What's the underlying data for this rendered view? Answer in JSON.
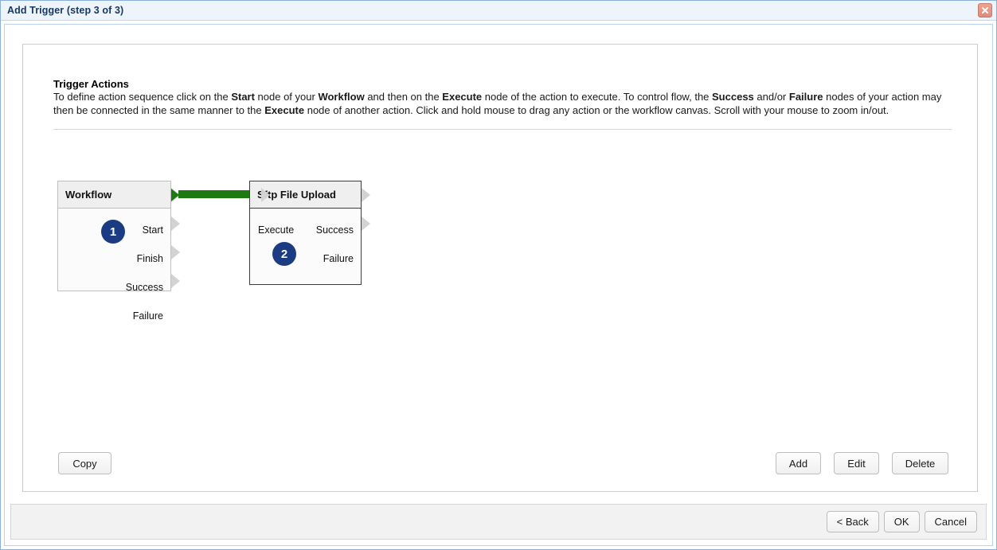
{
  "window": {
    "title": "Add Trigger (step 3 of 3)",
    "close_icon": "close-icon"
  },
  "panel": {
    "section_title": "Trigger Actions",
    "instructions": {
      "p1": "To define action sequence click on the ",
      "b1": "Start",
      "p2": " node of your ",
      "b2": "Workflow",
      "p3": " and then on the ",
      "b3": "Execute",
      "p4": " node of the action to execute. To control flow, the ",
      "b4": "Success",
      "p5": " and/or ",
      "b5": "Failure",
      "p6": " nodes of your action may then be connected in the same manner to the ",
      "b6": "Execute",
      "p7": " node of another action. Click and hold mouse to drag any action or the workflow canvas. Scroll with your mouse to zoom in/out."
    }
  },
  "workflow": {
    "nodes": [
      {
        "id": "workflow-node",
        "title": "Workflow",
        "selected": false,
        "outputs": [
          "Start",
          "Finish",
          "Success",
          "Failure"
        ],
        "inputs": [],
        "badge": "1",
        "badge_port": "Start"
      },
      {
        "id": "sftp-file-upload-node",
        "title": "Sftp File Upload",
        "selected": true,
        "outputs": [
          "Success",
          "Failure"
        ],
        "inputs": [
          "Execute"
        ],
        "badge": "2",
        "badge_port": "Execute"
      }
    ],
    "connection": {
      "from": "Workflow.Start",
      "to": "Sftp File Upload.Execute",
      "color": "#1d7a10"
    }
  },
  "buttons": {
    "copy": "Copy",
    "add": "Add",
    "edit": "Edit",
    "delete": "Delete"
  },
  "footer": {
    "back": "< Back",
    "ok": "OK",
    "cancel": "Cancel"
  },
  "colors": {
    "title_text": "#17375e",
    "titlebar_bg": "#eef4fc",
    "badge_bg": "#1b3c82",
    "connector": "#1d7a10",
    "close_btn": "#e08c79"
  }
}
